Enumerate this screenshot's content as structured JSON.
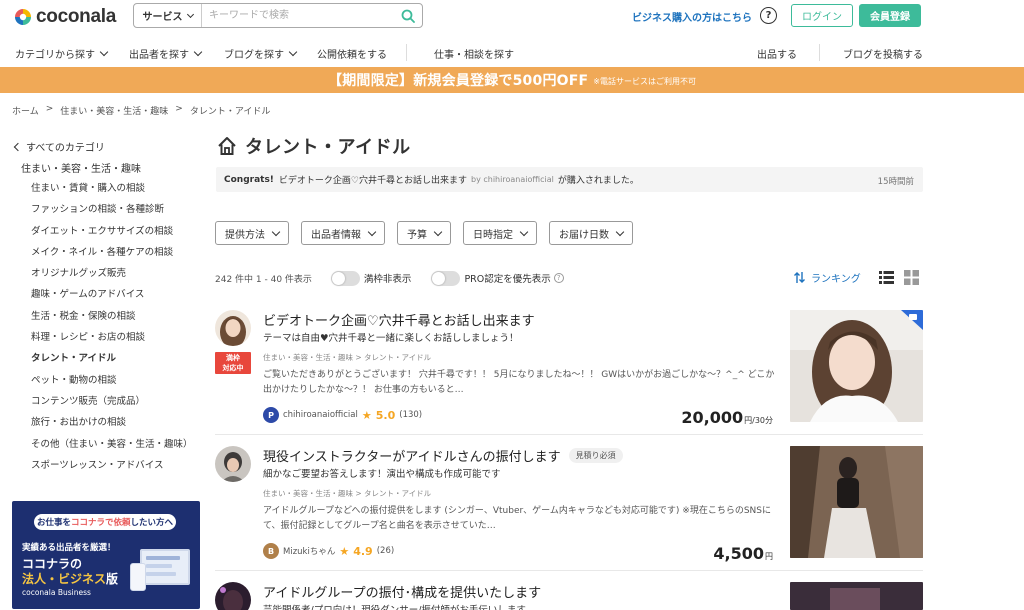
{
  "header": {
    "logo_text": "coconala",
    "search_category": "サービス",
    "search_placeholder": "キーワードで検索",
    "business_link": "ビジネス購入の方はこちら",
    "help_icon": "question-circle-icon",
    "login_label": "ログイン",
    "register_label": "会員登録"
  },
  "nav": {
    "items": [
      "カテゴリから探す",
      "出品者を探す",
      "ブログを探す",
      "公開依頼をする",
      "仕事・相談を探す",
      "出品する",
      "ブログを投稿する"
    ]
  },
  "banner": {
    "main": "【期間限定】新規会員登録で500円OFF",
    "note": "※電話サービスはご利用不可"
  },
  "breadcrumb": [
    "ホーム",
    "住まい・美容・生活・趣味",
    "タレント・アイドル"
  ],
  "sidebar": {
    "all_categories": "すべてのカテゴリ",
    "parent": "住まい・美容・生活・趣味",
    "items": [
      "住まい・賃貸・購入の相談",
      "ファッションの相談・各種診断",
      "ダイエット・エクササイズの相談",
      "メイク・ネイル・各種ケアの相談",
      "オリジナルグッズ販売",
      "趣味・ゲームのアドバイス",
      "生活・税金・保険の相談",
      "料理・レシピ・お店の相談",
      "タレント・アイドル",
      "ペット・動物の相談",
      "コンテンツ販売（完成品）",
      "旅行・お出かけの相談",
      "その他（住まい・美容・生活・趣味）",
      "スポーツレッスン・アドバイス"
    ],
    "active_index": 8
  },
  "promo": {
    "tag_prefix": "お仕事を",
    "tag_highlight": "ココナラで依頼",
    "tag_suffix": "したい方へ",
    "line1": "実績ある出品者を厳選！",
    "line2": "ココナラの",
    "line3_highlight": "法人・ビジネス",
    "line3_suffix": "版",
    "logo": "coconala Business"
  },
  "main": {
    "title": "タレント・アイドル",
    "congrats": {
      "label": "Congrats!",
      "service": "ビデオトーク企画♡穴井千尋とお話し出来ます",
      "by": "by chihiroanaiofficial",
      "suffix": "が購入されました。",
      "time": "15時間前"
    },
    "filters": [
      "提供方法",
      "出品者情報",
      "予算",
      "日時指定",
      "お届け日数"
    ],
    "count_text": "242 件中 1 - 40 件表示",
    "toggle1": "満枠非表示",
    "toggle2": "PRO認定を優先表示",
    "ranking": "ランキング"
  },
  "listings": [
    {
      "title": "ビデオトーク企画♡穴井千尋とお話し出来ます",
      "tag": "",
      "subtitle": "テーマは自由♥穴井千尋と一緒に楽しくお話ししましょう！",
      "category": "住まい・美容・生活・趣味 > タレント・アイドル",
      "description": "ご覧いただきありがとうございます！ 穴井千尋です！！ 5月になりましたね〜！！ GWはいかがお過ごしかな〜？^_^ どこか出かけたりしたかな〜？！ お仕事の方もいると…",
      "badge": "満枠対応中",
      "rank_badge": "P",
      "rank_color": "#2d4aa8",
      "seller": "chihiroanaiofficial",
      "score": "5.0",
      "reviews": "(130)",
      "price": "20,000",
      "price_unit": "円/30分"
    },
    {
      "title": "現役インストラクターがアイドルさんの振付します",
      "tag": "見積り必須",
      "subtitle": "細かなご要望お答えします！演出や構成も作成可能です",
      "category": "住まい・美容・生活・趣味 > タレント・アイドル",
      "description": "アイドルグループなどへの振付提供をします (シンガー、Vtuber、ゲーム内キャラなども対応可能です) ※現在こちらのSNSにて、振付記録としてグループ名と曲名を表示させていた…",
      "badge": "",
      "rank_badge": "B",
      "rank_color": "#b0804a",
      "seller": "Mizukiちゃん",
      "score": "4.9",
      "reviews": "(26)",
      "price": "4,500",
      "price_unit": "円"
    },
    {
      "title": "アイドルグループの振付･構成を提供いたします",
      "tag": "",
      "subtitle": "芸能関係者/プロ向け！現役ダンサー/振付師がお手伝いします",
      "category": "",
      "description": "",
      "badge": "",
      "rank_badge": "",
      "rank_color": "",
      "seller": "",
      "score": "",
      "reviews": "",
      "price": "",
      "price_unit": ""
    }
  ],
  "colors": {
    "brand_green": "#3dbb9a",
    "banner_orange": "#f0a957",
    "link_blue": "#1e73be",
    "star": "#f5a623"
  }
}
